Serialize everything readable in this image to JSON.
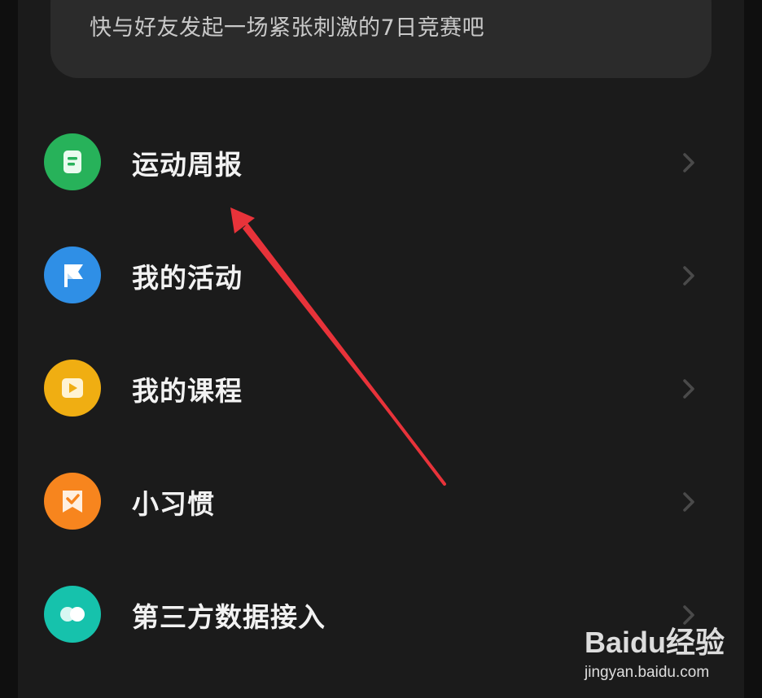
{
  "banner": {
    "text": "快与好友发起一场紧张刺激的7日竞赛吧"
  },
  "menu": {
    "items": [
      {
        "label": "运动周报",
        "icon": "weekly-report-icon",
        "color": "#27b25a"
      },
      {
        "label": "我的活动",
        "icon": "flag-icon",
        "color": "#2f8fe6"
      },
      {
        "label": "我的课程",
        "icon": "play-course-icon",
        "color": "#f0ae12"
      },
      {
        "label": "小习惯",
        "icon": "habit-bookmark-icon",
        "color": "#f7851e"
      },
      {
        "label": "第三方数据接入",
        "icon": "link-circles-icon",
        "color": "#16c2ac"
      }
    ]
  },
  "colors": {
    "background": "#1b1b1b",
    "card": "#2b2b2b",
    "label": "#f2f2f2",
    "chevron": "#4a4a4a",
    "annotation_arrow": "#e8333a"
  },
  "watermark": {
    "brand": "Baidu经验",
    "url": "jingyan.baidu.com"
  }
}
